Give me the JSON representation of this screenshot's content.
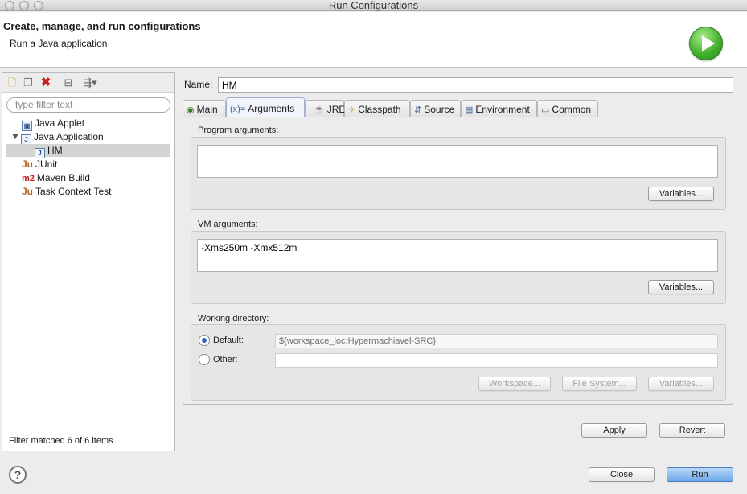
{
  "window": {
    "title": "Run Configurations"
  },
  "header": {
    "title": "Create, manage, and run configurations",
    "subtitle": "Run a Java application",
    "icon": "run-icon"
  },
  "left_panel": {
    "toolbar_icons": [
      "new-config-icon",
      "duplicate-icon",
      "delete-icon",
      "collapse-all-icon",
      "filter-icon"
    ],
    "filter_placeholder": "type filter text",
    "tree": [
      {
        "label": "Java Applet",
        "icon": "java-applet-icon",
        "level": 1
      },
      {
        "label": "Java Application",
        "icon": "java-app-icon",
        "level": 1,
        "expanded": true
      },
      {
        "label": "HM",
        "icon": "java-app-icon",
        "level": 2,
        "selected": true
      },
      {
        "label": "JUnit",
        "icon": "junit-icon",
        "level": 1
      },
      {
        "label": "Maven Build",
        "icon": "maven-icon",
        "level": 1
      },
      {
        "label": "Task Context Test",
        "icon": "junit-icon",
        "level": 1
      }
    ],
    "status": "Filter matched 6 of 6 items"
  },
  "config": {
    "name_label": "Name:",
    "name_value": "HM",
    "tabs": [
      {
        "label": "Main"
      },
      {
        "label": "Arguments",
        "active": true
      },
      {
        "label": "JRE"
      },
      {
        "label": "Classpath"
      },
      {
        "label": "Source"
      },
      {
        "label": "Environment"
      },
      {
        "label": "Common"
      }
    ],
    "program_args": {
      "label": "Program arguments:",
      "value": "",
      "variables_btn": "Variables..."
    },
    "vm_args": {
      "label": "VM arguments:",
      "value": "-Xms250m -Xmx512m",
      "variables_btn": "Variables..."
    },
    "working_dir": {
      "label": "Working directory:",
      "default_label": "Default:",
      "default_value": "${workspace_loc:Hypermachiavel-SRC}",
      "other_label": "Other:",
      "other_value": "",
      "workspace_btn": "Workspace...",
      "filesystem_btn": "File System...",
      "variables_btn": "Variables..."
    },
    "apply_btn": "Apply",
    "revert_btn": "Revert"
  },
  "footer": {
    "close_btn": "Close",
    "run_btn": "Run"
  }
}
